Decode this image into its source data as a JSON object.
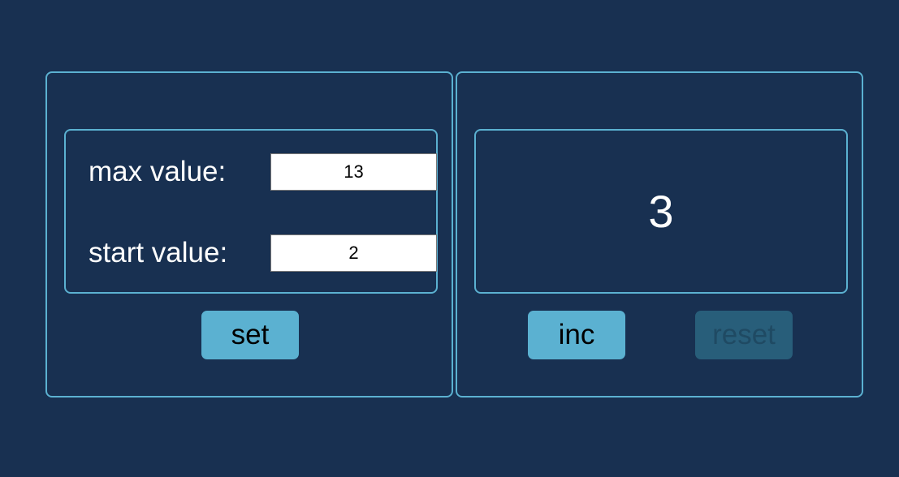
{
  "settings": {
    "max_label": "max value:",
    "max_value": "13",
    "start_label": "start value:",
    "start_value": "2",
    "set_label": "set"
  },
  "counter": {
    "value": "3",
    "inc_label": "inc",
    "reset_label": "reset",
    "reset_disabled": true
  },
  "colors": {
    "background": "#183051",
    "accent": "#5bb1d1",
    "disabled": "#285e7a"
  }
}
